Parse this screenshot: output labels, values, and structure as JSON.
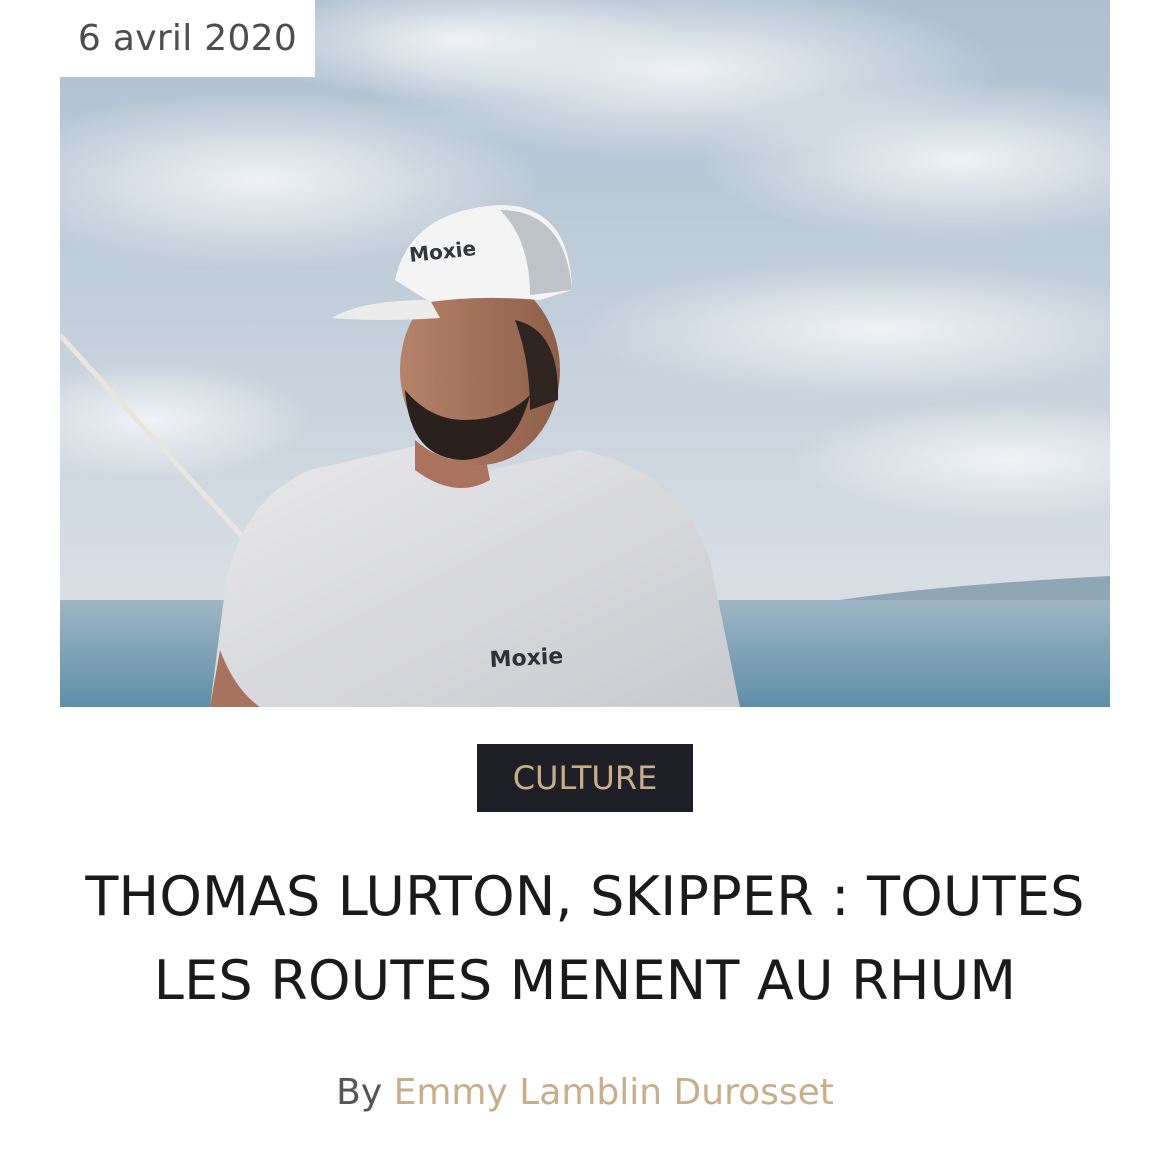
{
  "post": {
    "date": "6 avril 2020",
    "category": "CULTURE",
    "title": "THOMAS LURTON, SKIPPER : TOUTES LES ROUTES MENENT AU RHUM",
    "byline_prefix": "By",
    "author": "Emmy Lamblin Durosset",
    "image_logo_text": "Moxie"
  },
  "colors": {
    "category_bg": "#1f2027",
    "accent": "#c9ae8c",
    "title": "#1a1a1a",
    "muted_text": "#555555"
  }
}
